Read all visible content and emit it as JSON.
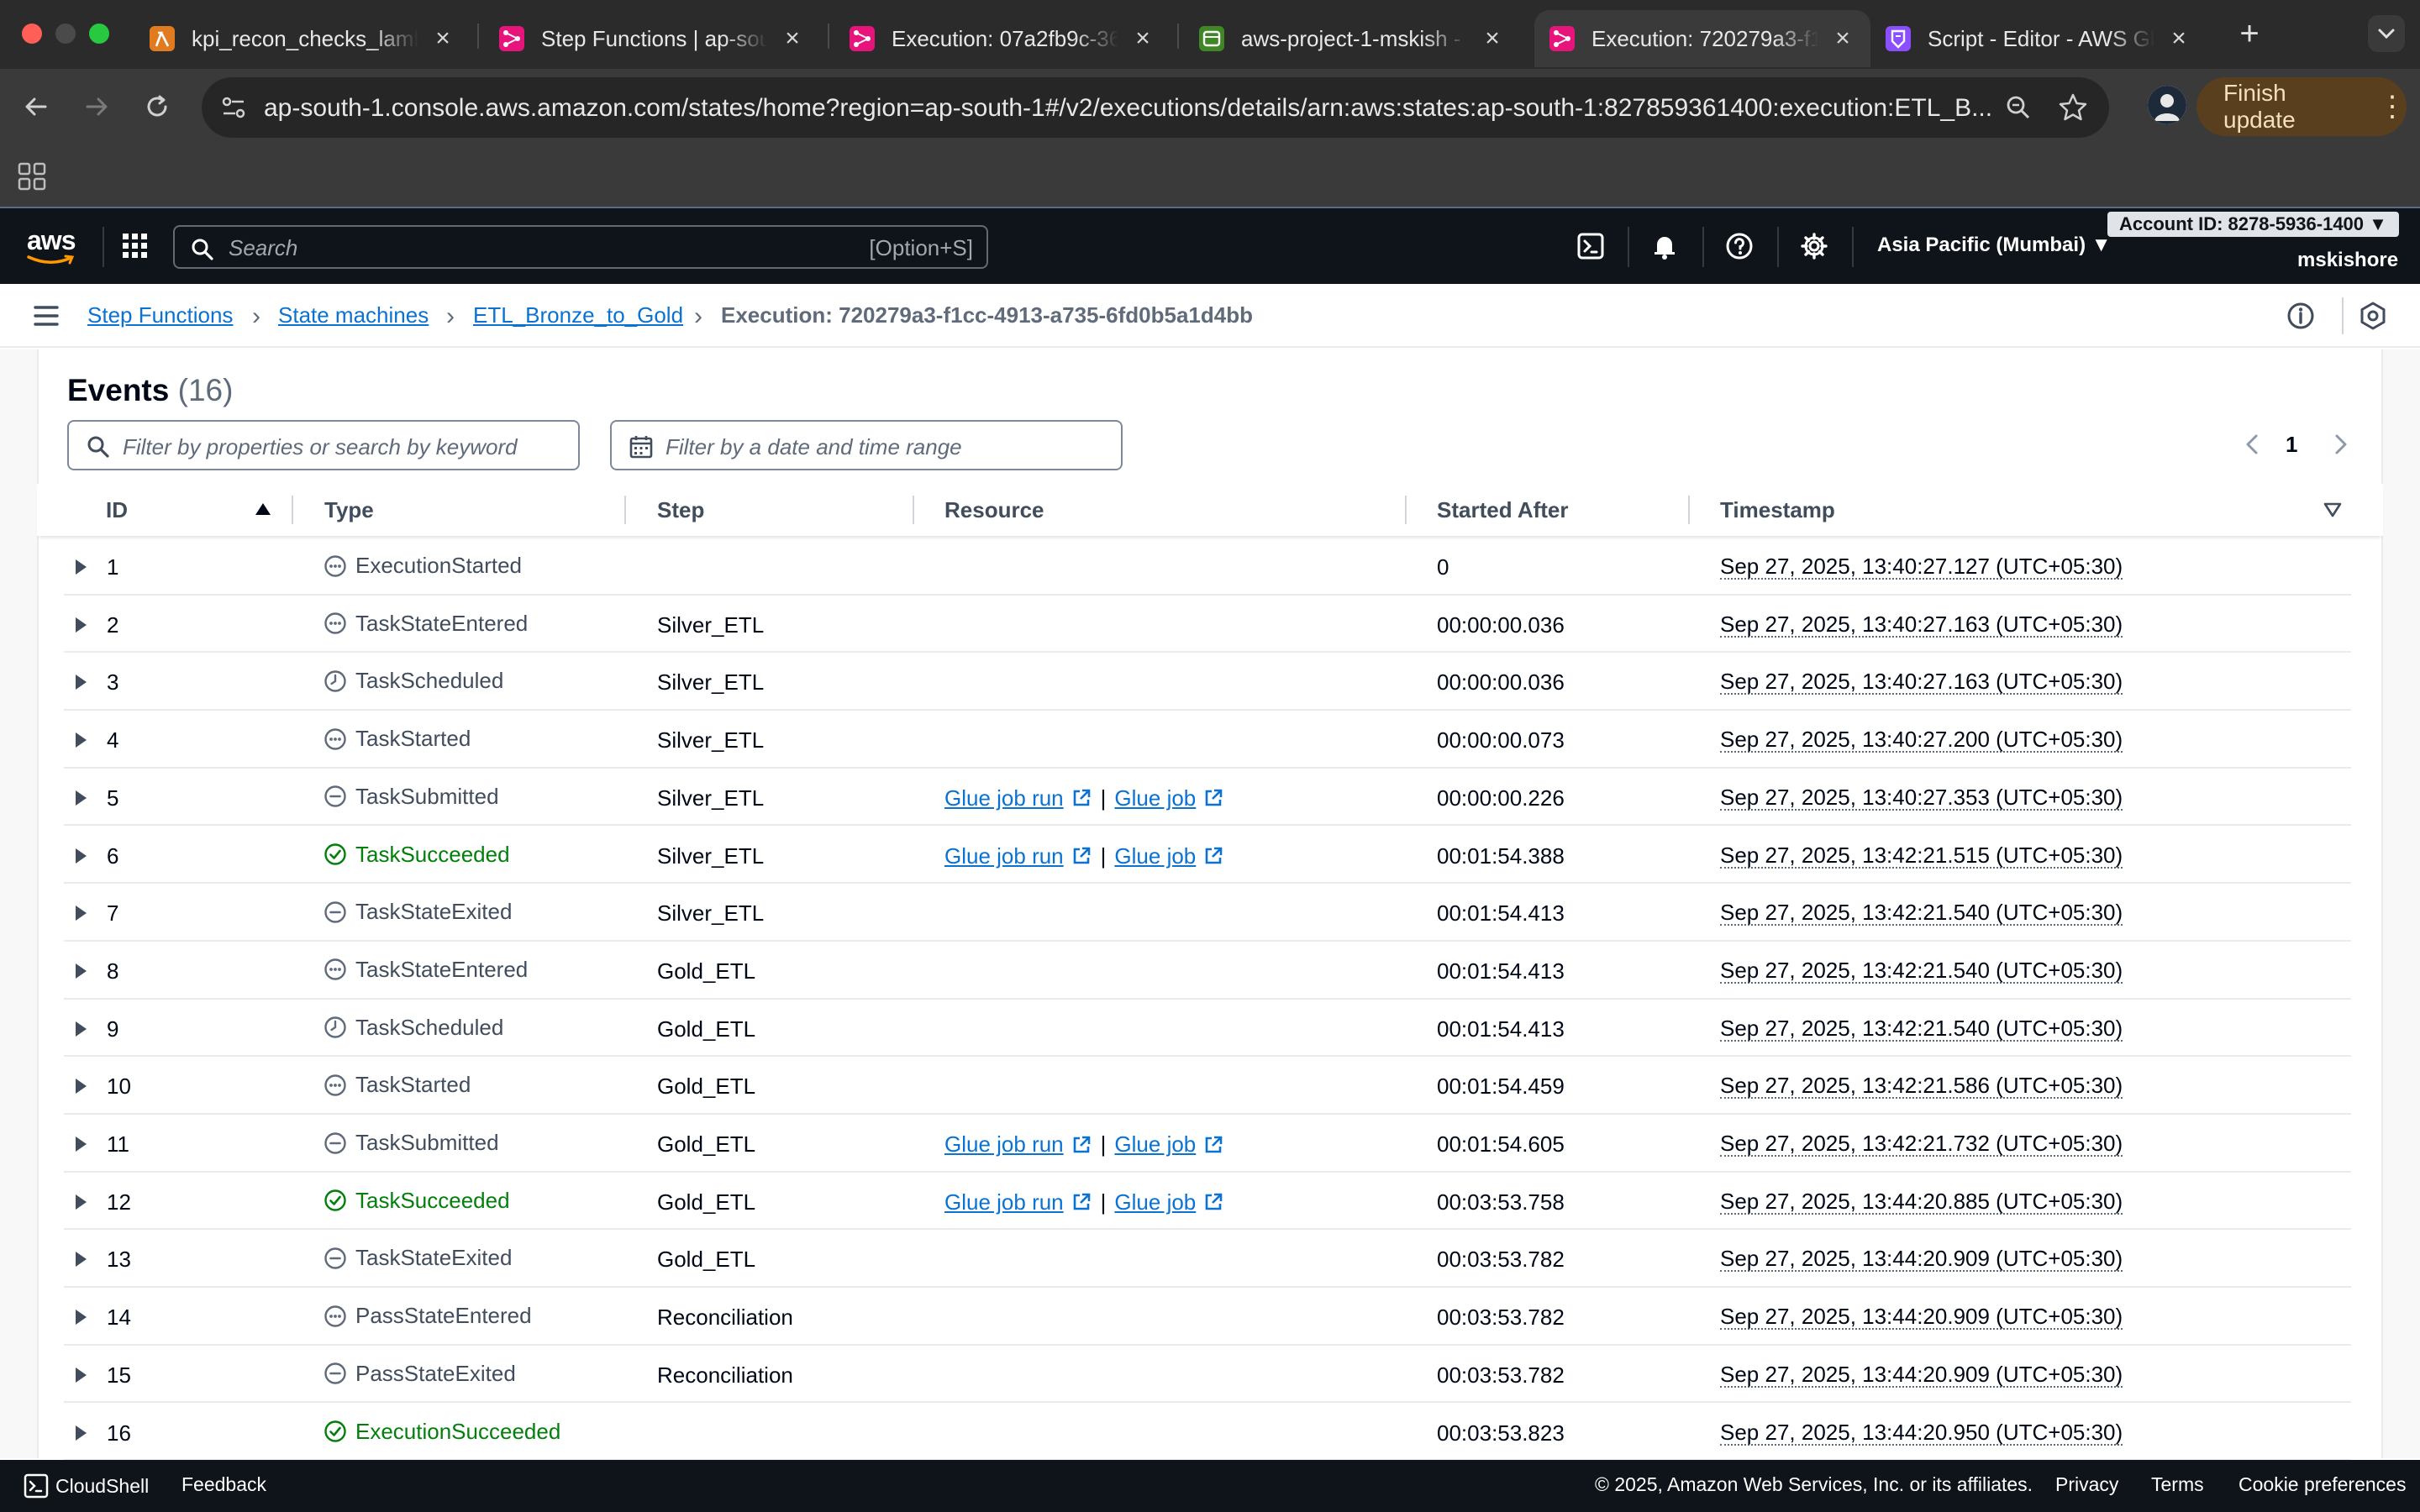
{
  "browser": {
    "tabs": [
      {
        "title": "kpi_recon_checks_lamb",
        "favicon_color": "#e07b20",
        "favicon": "lambda-icon"
      },
      {
        "title": "Step Functions | ap-sout",
        "favicon_color": "#e7157b",
        "favicon": "step-functions-icon"
      },
      {
        "title": "Execution: 07a2fb9c-36",
        "favicon_color": "#e7157b",
        "favicon": "step-functions-icon"
      },
      {
        "title": "aws-project-1-mskish -",
        "favicon_color": "#3f8624",
        "favicon": "s3-icon"
      },
      {
        "title": "Execution: 720279a3-f1",
        "favicon_color": "#e7157b",
        "favicon": "step-functions-icon",
        "active": true
      },
      {
        "title": "Script - Editor - AWS Gl",
        "favicon_color": "#8c4fff",
        "favicon": "glue-icon"
      }
    ],
    "url": "ap-south-1.console.aws.amazon.com/states/home?region=ap-south-1#/v2/executions/details/arn:aws:states:ap-south-1:827859361400:execution:ETL_B...",
    "finish_update_label": "Finish update"
  },
  "aws_nav": {
    "search_placeholder": "Search",
    "search_shortcut": "[Option+S]",
    "region": "Asia Pacific (Mumbai) ▼",
    "account": "Account ID: 8278-5936-1400 ▼",
    "user": "mskishore"
  },
  "breadcrumb": {
    "items": [
      "Step Functions",
      "State machines",
      "ETL_Bronze_to_Gold"
    ],
    "current": "Execution: 720279a3-f1cc-4913-a735-6fd0b5a1d4bb"
  },
  "events": {
    "title": "Events",
    "count": "(16)",
    "filter_placeholder": "Filter by properties or search by keyword",
    "date_placeholder": "Filter by a date and time range",
    "page": "1",
    "columns": [
      "ID",
      "Type",
      "Step",
      "Resource",
      "Started After",
      "Timestamp"
    ],
    "resource_links": {
      "run": "Glue job run",
      "job": "Glue job",
      "sep": "|"
    },
    "rows": [
      {
        "id": "1",
        "type": "ExecutionStarted",
        "status": "progress",
        "step": "",
        "res": false,
        "after": "0",
        "ts": "Sep 27, 2025, 13:40:27.127 (UTC+05:30)"
      },
      {
        "id": "2",
        "type": "TaskStateEntered",
        "status": "progress",
        "step": "Silver_ETL",
        "res": false,
        "after": "00:00:00.036",
        "ts": "Sep 27, 2025, 13:40:27.163 (UTC+05:30)"
      },
      {
        "id": "3",
        "type": "TaskScheduled",
        "status": "pending",
        "step": "Silver_ETL",
        "res": false,
        "after": "00:00:00.036",
        "ts": "Sep 27, 2025, 13:40:27.163 (UTC+05:30)"
      },
      {
        "id": "4",
        "type": "TaskStarted",
        "status": "progress",
        "step": "Silver_ETL",
        "res": false,
        "after": "00:00:00.073",
        "ts": "Sep 27, 2025, 13:40:27.200 (UTC+05:30)"
      },
      {
        "id": "5",
        "type": "TaskSubmitted",
        "status": "stopped",
        "step": "Silver_ETL",
        "res": true,
        "after": "00:00:00.226",
        "ts": "Sep 27, 2025, 13:40:27.353 (UTC+05:30)"
      },
      {
        "id": "6",
        "type": "TaskSucceeded",
        "status": "success",
        "step": "Silver_ETL",
        "res": true,
        "after": "00:01:54.388",
        "ts": "Sep 27, 2025, 13:42:21.515 (UTC+05:30)"
      },
      {
        "id": "7",
        "type": "TaskStateExited",
        "status": "stopped",
        "step": "Silver_ETL",
        "res": false,
        "after": "00:01:54.413",
        "ts": "Sep 27, 2025, 13:42:21.540 (UTC+05:30)"
      },
      {
        "id": "8",
        "type": "TaskStateEntered",
        "status": "progress",
        "step": "Gold_ETL",
        "res": false,
        "after": "00:01:54.413",
        "ts": "Sep 27, 2025, 13:42:21.540 (UTC+05:30)"
      },
      {
        "id": "9",
        "type": "TaskScheduled",
        "status": "pending",
        "step": "Gold_ETL",
        "res": false,
        "after": "00:01:54.413",
        "ts": "Sep 27, 2025, 13:42:21.540 (UTC+05:30)"
      },
      {
        "id": "10",
        "type": "TaskStarted",
        "status": "progress",
        "step": "Gold_ETL",
        "res": false,
        "after": "00:01:54.459",
        "ts": "Sep 27, 2025, 13:42:21.586 (UTC+05:30)"
      },
      {
        "id": "11",
        "type": "TaskSubmitted",
        "status": "stopped",
        "step": "Gold_ETL",
        "res": true,
        "after": "00:01:54.605",
        "ts": "Sep 27, 2025, 13:42:21.732 (UTC+05:30)"
      },
      {
        "id": "12",
        "type": "TaskSucceeded",
        "status": "success",
        "step": "Gold_ETL",
        "res": true,
        "after": "00:03:53.758",
        "ts": "Sep 27, 2025, 13:44:20.885 (UTC+05:30)"
      },
      {
        "id": "13",
        "type": "TaskStateExited",
        "status": "stopped",
        "step": "Gold_ETL",
        "res": false,
        "after": "00:03:53.782",
        "ts": "Sep 27, 2025, 13:44:20.909 (UTC+05:30)"
      },
      {
        "id": "14",
        "type": "PassStateEntered",
        "status": "progress",
        "step": "Reconciliation",
        "res": false,
        "after": "00:03:53.782",
        "ts": "Sep 27, 2025, 13:44:20.909 (UTC+05:30)"
      },
      {
        "id": "15",
        "type": "PassStateExited",
        "status": "stopped",
        "step": "Reconciliation",
        "res": false,
        "after": "00:03:53.782",
        "ts": "Sep 27, 2025, 13:44:20.909 (UTC+05:30)"
      },
      {
        "id": "16",
        "type": "ExecutionSucceeded",
        "status": "success",
        "step": "",
        "res": false,
        "after": "00:03:53.823",
        "ts": "Sep 27, 2025, 13:44:20.950 (UTC+05:30)"
      }
    ]
  },
  "footer": {
    "cloudshell": "CloudShell",
    "feedback": "Feedback",
    "copyright": "© 2025, Amazon Web Services, Inc. or its affiliates.",
    "privacy": "Privacy",
    "terms": "Terms",
    "cookies": "Cookie preferences"
  },
  "colors": {
    "link": "#0972d3",
    "success": "#037f0c",
    "aws_nav_bg": "#0f141a"
  }
}
